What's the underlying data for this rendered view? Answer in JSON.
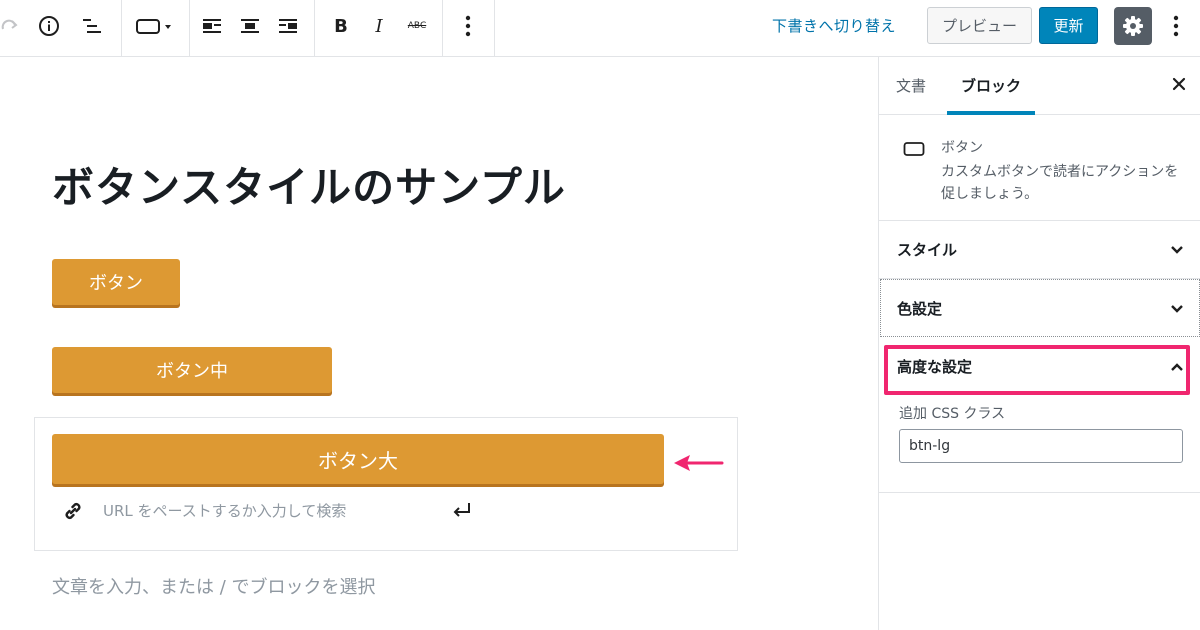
{
  "toolbar": {
    "draft_link": "下書きへ切り替え",
    "preview_label": "プレビュー",
    "update_label": "更新",
    "icons": [
      "redo-icon",
      "info-icon",
      "list-view-icon",
      "button-block-icon",
      "align-left-icon",
      "align-center-icon",
      "align-right-icon",
      "bold-icon",
      "italic-icon",
      "strikethrough-icon",
      "more-options-icon",
      "settings-gear-icon",
      "more-menu-icon"
    ],
    "bold_glyph": "B",
    "italic_glyph": "I",
    "strike_glyph": "ABC",
    "accent_color": "#0085ba"
  },
  "editor": {
    "title": "ボタンスタイルのサンプル",
    "buttons": [
      "ボタン",
      "ボタン中",
      "ボタン大"
    ],
    "button_color": "#dd9933",
    "url_placeholder": "URL をペーストするか入力して検索",
    "paragraph_placeholder": "文章を入力、または / でブロックを選択"
  },
  "sidebar": {
    "tabs": [
      "文書",
      "ブロック"
    ],
    "block_name": "ボタン",
    "block_description": "カスタムボタンで読者にアクションを促しましょう。",
    "panels": [
      "スタイル",
      "色設定",
      "高度な設定"
    ],
    "advanced": {
      "css_label": "追加 CSS クラス",
      "css_value": "btn-lg"
    },
    "highlight_color": "#f0266f"
  }
}
